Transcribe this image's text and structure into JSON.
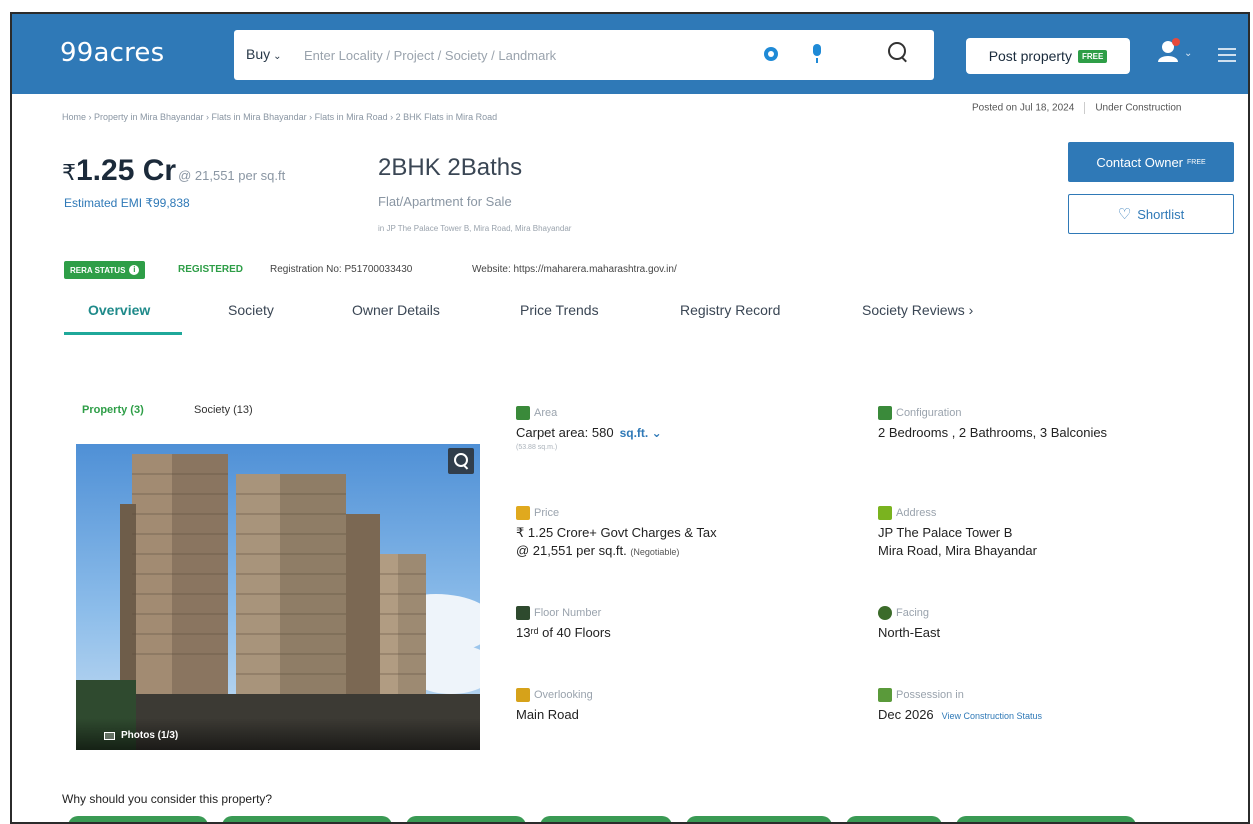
{
  "header": {
    "logo": "99acres",
    "search": {
      "buy_label": "Buy",
      "placeholder": "Enter Locality / Project / Society / Landmark"
    },
    "post_property_label": "Post property",
    "free_badge": "FREE"
  },
  "breadcrumb": "Home › Property in Mira Bhayandar › Flats in Mira Bhayandar › Flats in Mira Road › 2 BHK Flats in Mira Road",
  "posted_on": "Posted on Jul 18, 2024",
  "status": "Under Construction",
  "price": {
    "rupee": "₹",
    "amount": "1.25 Cr",
    "per_sqft": "@ 21,551 per sq.ft",
    "emi": "Estimated EMI ₹99,838"
  },
  "title": "2BHK 2Baths",
  "subtitle": "Flat/Apartment for Sale",
  "location_small": "in JP The Palace Tower B, Mira Road, Mira Bhayandar",
  "contact_owner": {
    "label": "Contact Owner",
    "badge": "FREE"
  },
  "shortlist_label": "Shortlist",
  "rera": {
    "badge": "RERA STATUS",
    "info": "i",
    "status": "REGISTERED",
    "registration": "Registration No: P51700033430",
    "website": "Website: https://maharera.maharashtra.gov.in/"
  },
  "tabs": [
    "Overview",
    "Society",
    "Owner Details",
    "Price Trends",
    "Registry Record",
    "Society Reviews  ›"
  ],
  "photo_tabs": {
    "property": "Property (3)",
    "society": "Society (13)"
  },
  "photos_label": "Photos (1/3)",
  "details": {
    "area": {
      "label": "Area",
      "value": "Carpet area: 580",
      "unit": "sq.ft. ⌄",
      "sub": "(53.88 sq.m.)"
    },
    "configuration": {
      "label": "Configuration",
      "value": "2 Bedrooms , 2 Bathrooms, 3 Balconies"
    },
    "price": {
      "label": "Price",
      "line1": "₹ 1.25 Crore+ Govt Charges & Tax",
      "line2": "@ 21,551 per sq.ft.",
      "negotiable": "(Negotiable)"
    },
    "address": {
      "label": "Address",
      "line1": "JP The Palace Tower B",
      "line2": "Mira Road, Mira Bhayandar"
    },
    "floor": {
      "label": "Floor Number",
      "value": "13ʳᵈ  of 40 Floors"
    },
    "facing": {
      "label": "Facing",
      "value": "North-East"
    },
    "overlooking": {
      "label": "Overlooking",
      "value": "Main Road"
    },
    "possession": {
      "label": "Possession in",
      "value": "Dec 2026",
      "link": "View Construction Status"
    }
  },
  "why_heading": "Why should you consider this property?",
  "colors": {
    "brand_blue": "#2f79b7",
    "green": "#2e9e47",
    "teal": "#1fa89a"
  }
}
